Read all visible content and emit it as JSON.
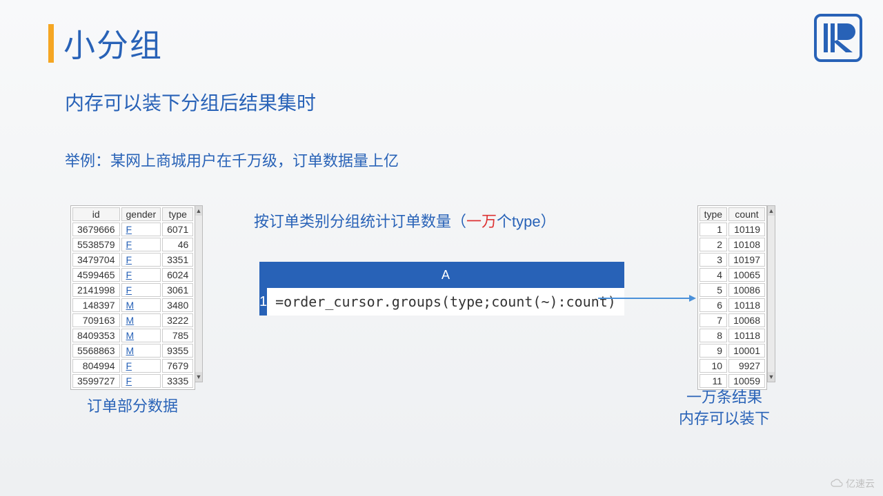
{
  "title": "小分组",
  "subtitle": "内存可以装下分组后结果集时",
  "example": "举例：某网上商城用户在千万级，订单数据量上亿",
  "mid_title_pre": "按订单类别分组统计订单数量（",
  "mid_title_red": "一万",
  "mid_title_post": "个type）",
  "left_headers": [
    "id",
    "gender",
    "type"
  ],
  "left_rows": [
    {
      "id": "3679666",
      "g": "F",
      "t": "6071"
    },
    {
      "id": "5538579",
      "g": "F",
      "t": "46"
    },
    {
      "id": "3479704",
      "g": "F",
      "t": "3351"
    },
    {
      "id": "4599465",
      "g": "F",
      "t": "6024"
    },
    {
      "id": "2141998",
      "g": "F",
      "t": "3061"
    },
    {
      "id": "148397",
      "g": "M",
      "t": "3480"
    },
    {
      "id": "709163",
      "g": "M",
      "t": "3222"
    },
    {
      "id": "8409353",
      "g": "M",
      "t": "785"
    },
    {
      "id": "5568863",
      "g": "M",
      "t": "9355"
    },
    {
      "id": "804994",
      "g": "F",
      "t": "7679"
    },
    {
      "id": "3599727",
      "g": "F",
      "t": "3335"
    }
  ],
  "left_caption": "订单部分数据",
  "right_headers": [
    "type",
    "count"
  ],
  "right_rows": [
    {
      "t": "1",
      "c": "10119"
    },
    {
      "t": "2",
      "c": "10108"
    },
    {
      "t": "3",
      "c": "10197"
    },
    {
      "t": "4",
      "c": "10065"
    },
    {
      "t": "5",
      "c": "10086"
    },
    {
      "t": "6",
      "c": "10118"
    },
    {
      "t": "7",
      "c": "10068"
    },
    {
      "t": "8",
      "c": "10118"
    },
    {
      "t": "9",
      "c": "10001"
    },
    {
      "t": "10",
      "c": "9927"
    },
    {
      "t": "11",
      "c": "10059"
    }
  ],
  "right_caption_l1": "一万条结果",
  "right_caption_l2": "内存可以装下",
  "code_header": "A",
  "code_row": "1",
  "code_text": "=order_cursor.groups(type;count(~):count)",
  "watermark": "亿速云"
}
